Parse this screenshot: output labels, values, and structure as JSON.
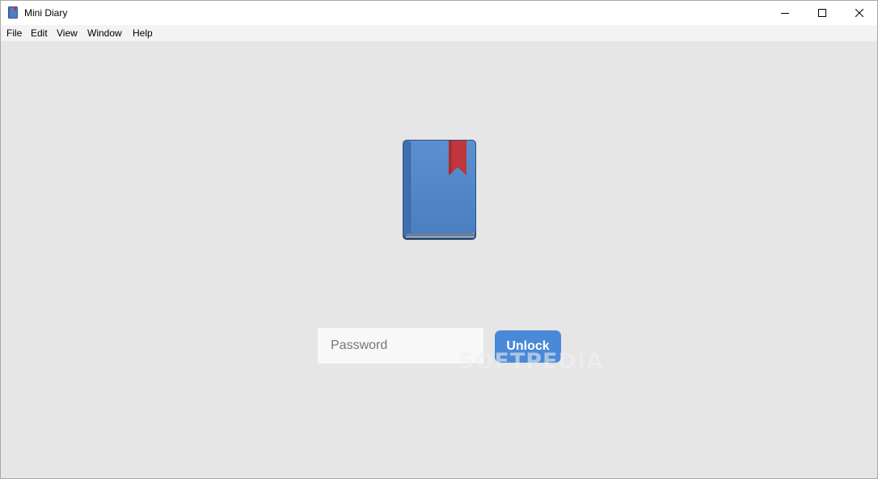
{
  "window": {
    "title": "Mini Diary",
    "icon": "diary-book-icon",
    "controls": {
      "minimize": "minimize-icon",
      "maximize": "maximize-icon",
      "close": "close-icon"
    }
  },
  "menu": {
    "items": [
      {
        "label": "File"
      },
      {
        "label": "Edit"
      },
      {
        "label": "View"
      },
      {
        "label": "Window"
      },
      {
        "label": "Help"
      }
    ]
  },
  "lock_screen": {
    "icon": "book-icon",
    "password": {
      "placeholder": "Password",
      "value": ""
    },
    "unlock_label": "Unlock"
  },
  "watermark": "SOFTPEDIA",
  "colors": {
    "background": "#e6e6e6",
    "accent": "#4a89d8",
    "book_cover": "#5188cc",
    "bookmark": "#c0363b"
  }
}
